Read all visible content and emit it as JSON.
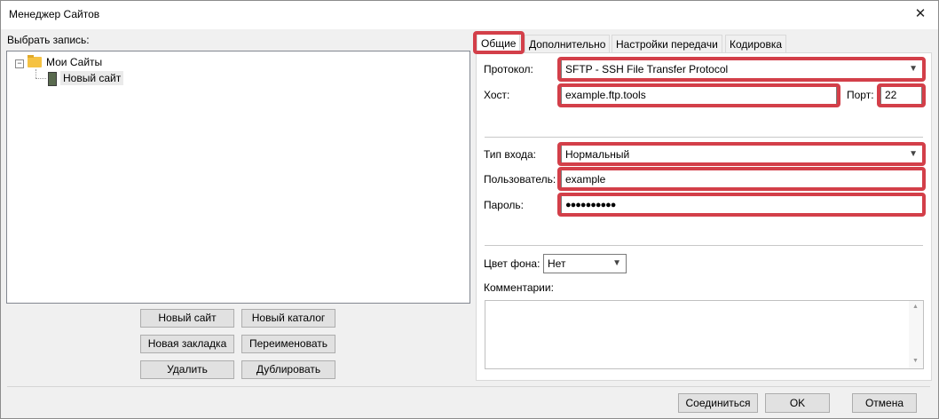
{
  "window": {
    "title": "Менеджер Сайтов"
  },
  "left": {
    "select_label": "Выбрать запись:",
    "tree": {
      "root": "Мои Сайты",
      "child": "Новый сайт"
    },
    "buttons": {
      "new_site": "Новый сайт",
      "new_folder": "Новый каталог",
      "new_bookmark": "Новая закладка",
      "rename": "Переименовать",
      "delete": "Удалить",
      "duplicate": "Дублировать"
    }
  },
  "tabs": [
    "Общие",
    "Дополнительно",
    "Настройки передачи",
    "Кодировка"
  ],
  "general": {
    "protocol_label": "Протокол:",
    "protocol_value": "SFTP - SSH File Transfer Protocol",
    "host_label": "Хост:",
    "host_value": "example.ftp.tools",
    "port_label": "Порт:",
    "port_value": "22",
    "logon_label": "Тип входа:",
    "logon_value": "Нормальный",
    "user_label": "Пользователь:",
    "user_value": "example",
    "password_label": "Пароль:",
    "password_value": "●●●●●●●●●●",
    "bgcolor_label": "Цвет фона:",
    "bgcolor_value": "Нет",
    "comments_label": "Комментарии:"
  },
  "footer": {
    "connect": "Соединиться",
    "ok": "OK",
    "cancel": "Отмена"
  },
  "colors": {
    "highlight": "#d33f49",
    "folder": "#f5c242"
  }
}
